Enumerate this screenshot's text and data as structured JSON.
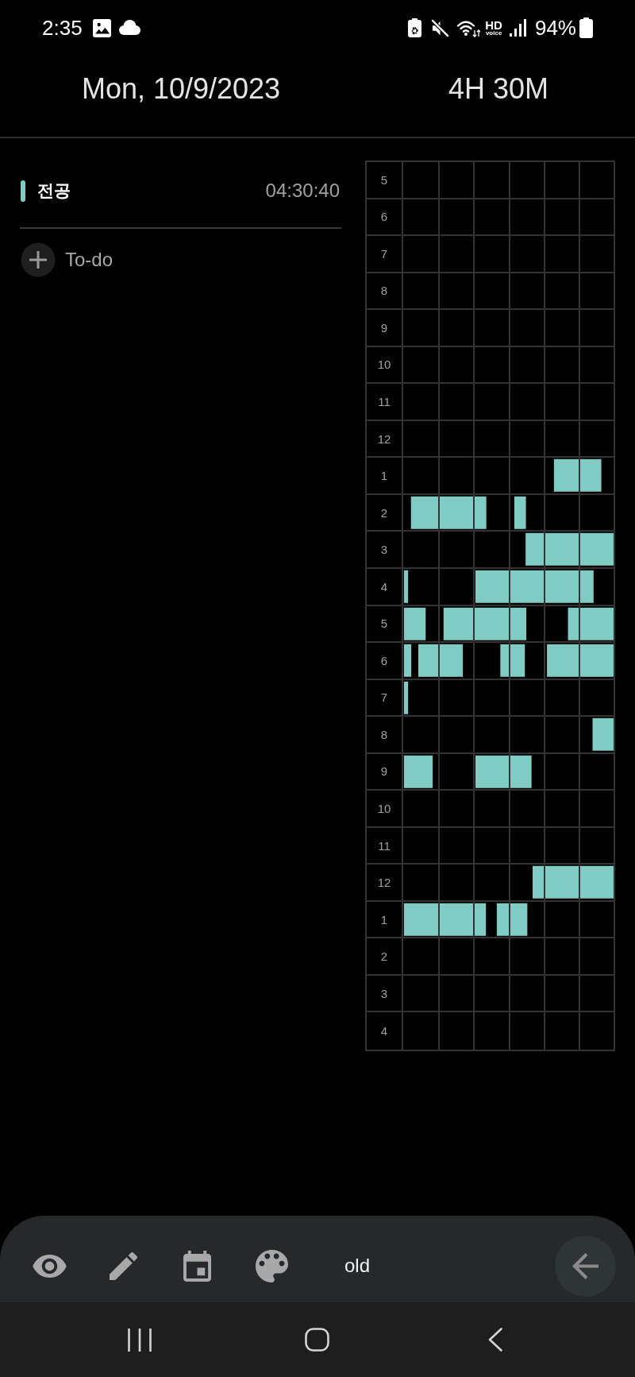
{
  "status_bar": {
    "time": "2:35",
    "hd_label": "HD",
    "voice_label": "voice",
    "battery": "94%"
  },
  "header": {
    "date": "Mon, 10/9/2023",
    "total": "4H 30M"
  },
  "subjects": [
    {
      "name": "전공",
      "time": "04:30:40",
      "color": "#80cbc4"
    }
  ],
  "todo": {
    "label": "To-do"
  },
  "timetable": {
    "hours": [
      "5",
      "6",
      "7",
      "8",
      "9",
      "10",
      "11",
      "12",
      "1",
      "2",
      "3",
      "4",
      "5",
      "6",
      "7",
      "8",
      "9",
      "10",
      "11",
      "12",
      "1",
      "2",
      "3",
      "4"
    ]
  },
  "toolbar": {
    "mode": "old"
  }
}
